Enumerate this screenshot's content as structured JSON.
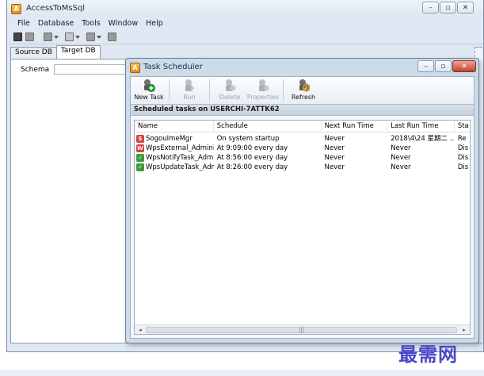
{
  "main_window": {
    "title": "AccessToMsSql",
    "icon": "app-icon",
    "menu": [
      "File",
      "Database",
      "Tools",
      "Window",
      "Help"
    ],
    "tabs": [
      "Source DB",
      "Target DB"
    ],
    "active_tab": "Target DB",
    "schema_label": "Schema",
    "schema_value": ""
  },
  "dialog": {
    "title": "Task Scheduler",
    "toolbar": [
      {
        "label": "New Task",
        "icon": "new-task-icon",
        "enabled": true
      },
      {
        "label": "Run",
        "icon": "run-icon",
        "enabled": false
      },
      {
        "label": "Delete",
        "icon": "delete-icon",
        "enabled": false
      },
      {
        "label": "Properties",
        "icon": "properties-icon",
        "enabled": false
      },
      {
        "label": "Refresh",
        "icon": "refresh-icon",
        "enabled": true
      }
    ],
    "header": "Scheduled tasks on USERCHI-7ATTK62",
    "columns": [
      "Name",
      "Schedule",
      "Next Run Time",
      "Last Run Time",
      "Sta"
    ],
    "rows": [
      {
        "name": "SogouImeMgr",
        "schedule": "On system startup",
        "next": "Never",
        "last": "2018\\4\\24 星期二 ...",
        "status": "Re",
        "icon": "sogou-icon"
      },
      {
        "name": "WpsExternal_Administ...",
        "schedule": "At 9:09:00 every day",
        "next": "Never",
        "last": "Never",
        "status": "Dis",
        "icon": "wps-red-icon"
      },
      {
        "name": "WpsNotifyTask_Admini...",
        "schedule": "At 8:56:00 every day",
        "next": "Never",
        "last": "Never",
        "status": "Dis",
        "icon": "wps-green-icon"
      },
      {
        "name": "WpsUpdateTask_Admi...",
        "schedule": "At 8:26:00 every day",
        "next": "Never",
        "last": "Never",
        "status": "Dis",
        "icon": "wps-green-icon"
      }
    ]
  },
  "watermark": "最需网"
}
